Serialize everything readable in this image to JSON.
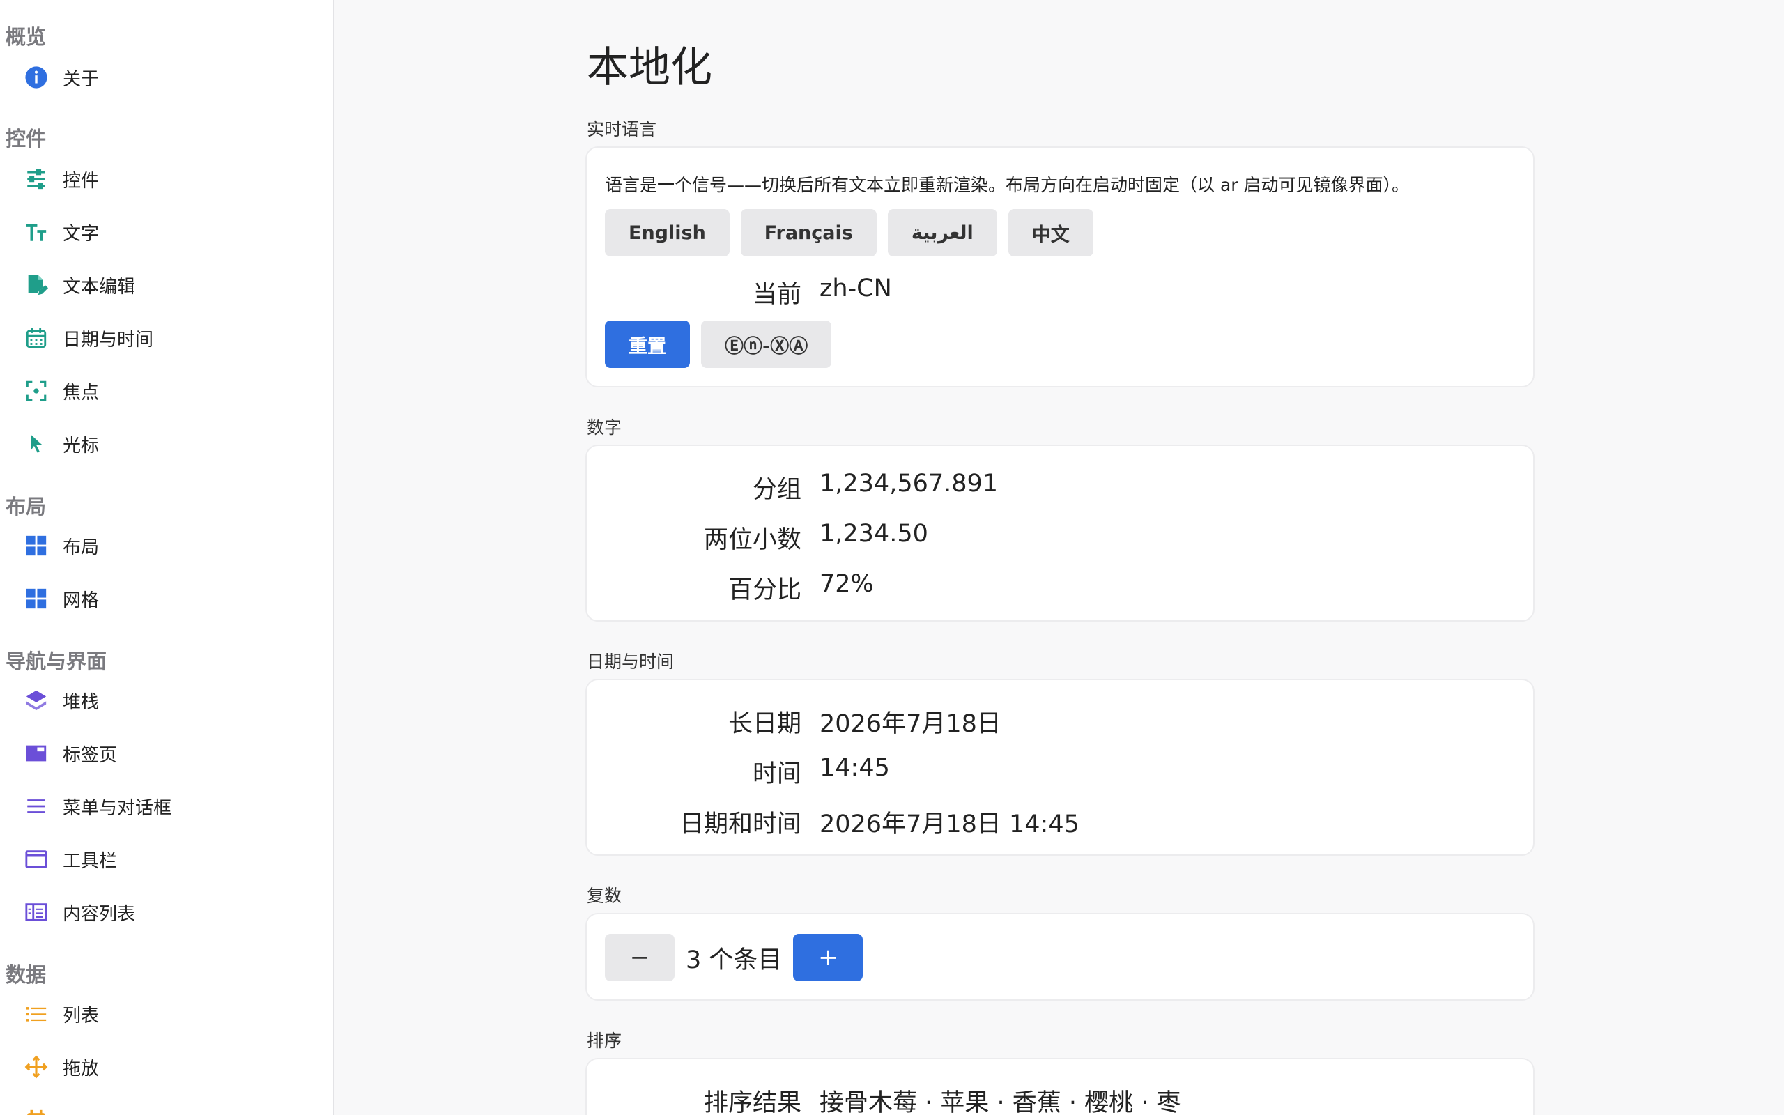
{
  "sidebar": {
    "sections": [
      {
        "title": "概览",
        "items": [
          {
            "label": "关于",
            "icon": "info-icon"
          }
        ]
      },
      {
        "title": "控件",
        "items": [
          {
            "label": "控件",
            "icon": "sliders-icon"
          },
          {
            "label": "文字",
            "icon": "text-size-icon"
          },
          {
            "label": "文本编辑",
            "icon": "edit-document-icon"
          },
          {
            "label": "日期与时间",
            "icon": "calendar-icon"
          },
          {
            "label": "焦点",
            "icon": "focus-icon"
          },
          {
            "label": "光标",
            "icon": "cursor-icon"
          }
        ]
      },
      {
        "title": "布局",
        "items": [
          {
            "label": "布局",
            "icon": "grid-icon"
          },
          {
            "label": "网格",
            "icon": "grid-icon"
          }
        ]
      },
      {
        "title": "导航与界面",
        "items": [
          {
            "label": "堆栈",
            "icon": "layers-icon"
          },
          {
            "label": "标签页",
            "icon": "tab-icon"
          },
          {
            "label": "菜单与对话框",
            "icon": "menu-icon"
          },
          {
            "label": "工具栏",
            "icon": "window-icon"
          },
          {
            "label": "内容列表",
            "icon": "columns-icon"
          }
        ]
      },
      {
        "title": "数据",
        "items": [
          {
            "label": "列表",
            "icon": "list-icon"
          },
          {
            "label": "拖放",
            "icon": "move-icon"
          },
          {
            "label": "…",
            "icon": "calendar-icon"
          }
        ]
      }
    ]
  },
  "main": {
    "title": "本地化",
    "live_language": {
      "label": "实时语言",
      "description": "语言是一个信号——切换后所有文本立即重新渲染。布局方向在启动时固定（以 ar 启动可见镜像界面）。",
      "languages": [
        "English",
        "Français",
        "العربية",
        "中文"
      ],
      "current_key": "当前",
      "current_value": "zh-CN",
      "reset_label": "重置",
      "pseudo_label": "Ⓔⓝ-ⓍⒶ"
    },
    "numbers": {
      "label": "数字",
      "rows": [
        {
          "key": "分组",
          "value": "1,234,567.891"
        },
        {
          "key": "两位小数",
          "value": "1,234.50"
        },
        {
          "key": "百分比",
          "value": "72%"
        }
      ]
    },
    "datetime": {
      "label": "日期与时间",
      "rows": [
        {
          "key": "长日期",
          "value": "2026年7月18日"
        },
        {
          "key": "时间",
          "value": "14:45"
        },
        {
          "key": "日期和时间",
          "value": "2026年7月18日 14:45"
        }
      ]
    },
    "plural": {
      "label": "复数",
      "minus_label": "−",
      "plus_label": "+",
      "text": "3 个条目"
    },
    "sorting": {
      "label": "排序",
      "key": "排序结果",
      "value": "接骨木莓 · 苹果 · 香蕉 · 樱桃 · 枣"
    }
  },
  "colors": {
    "teal": "#1f9e8a",
    "blue": "#2f6fe0",
    "purple": "#6b4fd8",
    "orange": "#f0a020"
  }
}
